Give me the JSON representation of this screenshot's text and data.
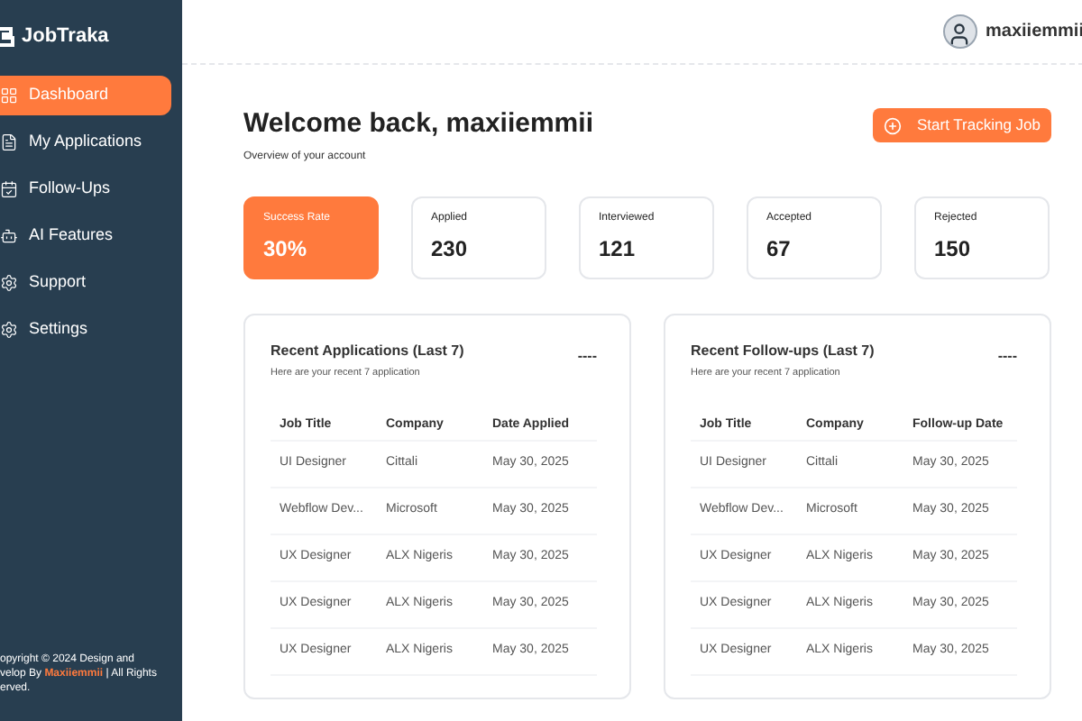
{
  "sidebar": {
    "brand": "JobTraka",
    "items": [
      {
        "label": "Dashboard",
        "selected": true
      },
      {
        "label": "My Applications",
        "selected": false
      },
      {
        "label": "Follow-Ups",
        "selected": false
      },
      {
        "label": "AI Features",
        "selected": false
      },
      {
        "label": "Support",
        "selected": false
      },
      {
        "label": "Settings",
        "selected": false
      }
    ],
    "footer_lines": [
      "opyright © 2024 Design and",
      "velop By **Maxiiemmii** | All Rights",
      "erved."
    ]
  },
  "header": {
    "username": "maxiiemmii"
  },
  "welcome": {
    "title": "Welcome back, maxiiemmii",
    "subtitle": "Overview of your account",
    "button": "Start Tracking Job"
  },
  "stats": [
    {
      "label": "Success Rate",
      "value": "30%",
      "selected": true
    },
    {
      "label": "Applied",
      "value": "230",
      "selected": false
    },
    {
      "label": "Interviewed",
      "value": "121",
      "selected": false
    },
    {
      "label": "Accepted",
      "value": "67",
      "selected": false
    },
    {
      "label": "Rejected",
      "value": "150",
      "selected": false
    }
  ],
  "panels": [
    {
      "title": "Recent Applications (Last 7)",
      "subtitle": "Here are your recent 7 application",
      "menu": "----",
      "columns": [
        "Job Title",
        "Company",
        "Date Applied"
      ],
      "rows": [
        [
          "UI Designer",
          "Cittali",
          "May 30, 2025"
        ],
        [
          "Webflow Dev...",
          "Microsoft",
          "May 30, 2025"
        ],
        [
          "UX Designer",
          "ALX Nigeris",
          "May 30, 2025"
        ],
        [
          "UX Designer",
          "ALX Nigeris",
          "May 30, 2025"
        ],
        [
          "UX Designer",
          "ALX Nigeris",
          "May 30, 2025"
        ]
      ]
    },
    {
      "title": "Recent Follow-ups (Last 7)",
      "subtitle": "Here are your recent 7 application",
      "menu": "----",
      "columns": [
        "Job Title",
        "Company",
        "Follow-up Date"
      ],
      "rows": [
        [
          "UI Designer",
          "Cittali",
          "May 30, 2025"
        ],
        [
          "Webflow Dev...",
          "Microsoft",
          "May 30, 2025"
        ],
        [
          "UX Designer",
          "ALX Nigeris",
          "May 30, 2025"
        ],
        [
          "UX Designer",
          "ALX Nigeris",
          "May 30, 2025"
        ],
        [
          "UX Designer",
          "ALX Nigeris",
          "May 30, 2025"
        ]
      ]
    }
  ]
}
